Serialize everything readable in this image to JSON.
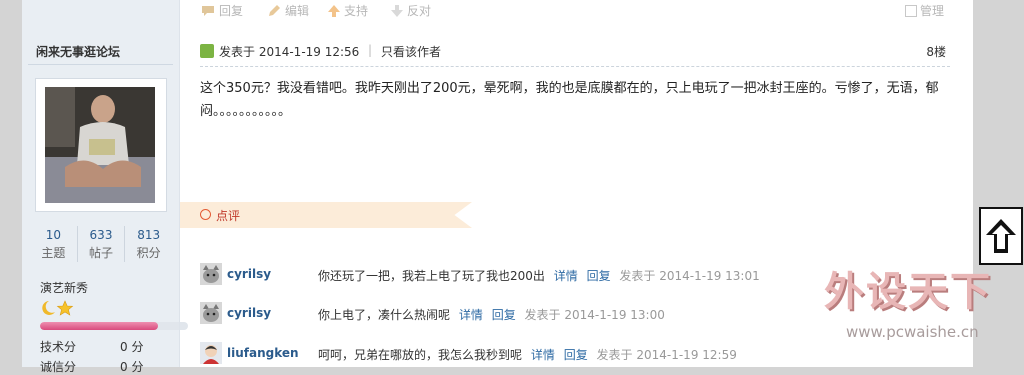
{
  "toolbar": {
    "reply": "回复",
    "edit": "编辑",
    "support": "支持",
    "oppose": "反对",
    "manage": "管理"
  },
  "sidebar": {
    "forum_name": "闲来无事逛论坛",
    "stats": [
      {
        "value": "10",
        "label": "主题"
      },
      {
        "value": "633",
        "label": "帖子"
      },
      {
        "value": "813",
        "label": "积分"
      }
    ],
    "rank": "演艺新秀",
    "progress_fraction": 0.8,
    "points": [
      {
        "label": "技术分",
        "value": "0 分"
      },
      {
        "label": "诚信分",
        "value": "0 分"
      }
    ]
  },
  "post": {
    "posted_at": "发表于 2014-1-19 12:56",
    "separator": "|",
    "only_author": "只看该作者",
    "floor": "8楼",
    "body": "这个350元？我没看错吧。我昨天刚出了200元，晕死啊，我的也是底膜都在的，只上电玩了一把冰封王座的。亏惨了，无语，郁闷。。。。。。。。。。。"
  },
  "comments_tab": "点评",
  "comments": [
    {
      "user": "cyrilsy",
      "text": "你还玩了一把，我若上电了玩了我也200出",
      "detail": "详情",
      "reply": "回复",
      "time": "发表于 2014-1-19 13:01"
    },
    {
      "user": "cyrilsy",
      "text": "你上电了，凑什么热闹呢",
      "detail": "详情",
      "reply": "回复",
      "time": "发表于 2014-1-19 13:00"
    },
    {
      "user": "liufangken",
      "text": "呵呵，兄弟在哪放的，我怎么我秒到呢",
      "detail": "详情",
      "reply": "回复",
      "time": "发表于 2014-1-19 12:59"
    }
  ],
  "watermark": {
    "brand": "外设天下",
    "url": "www.pcwaishe.cn"
  },
  "icons": {
    "reply": "speech-bubble-icon",
    "edit": "pencil-icon",
    "support": "thumb-up-icon",
    "oppose": "thumb-down-icon",
    "manage": "checkbox-icon",
    "scroll_top": "arrow-up-icon"
  },
  "colors": {
    "link": "#2f6ba4",
    "username": "#2b5b8c",
    "progress": "#d94b7d",
    "comment_tab_bg": "#fcecd9"
  }
}
